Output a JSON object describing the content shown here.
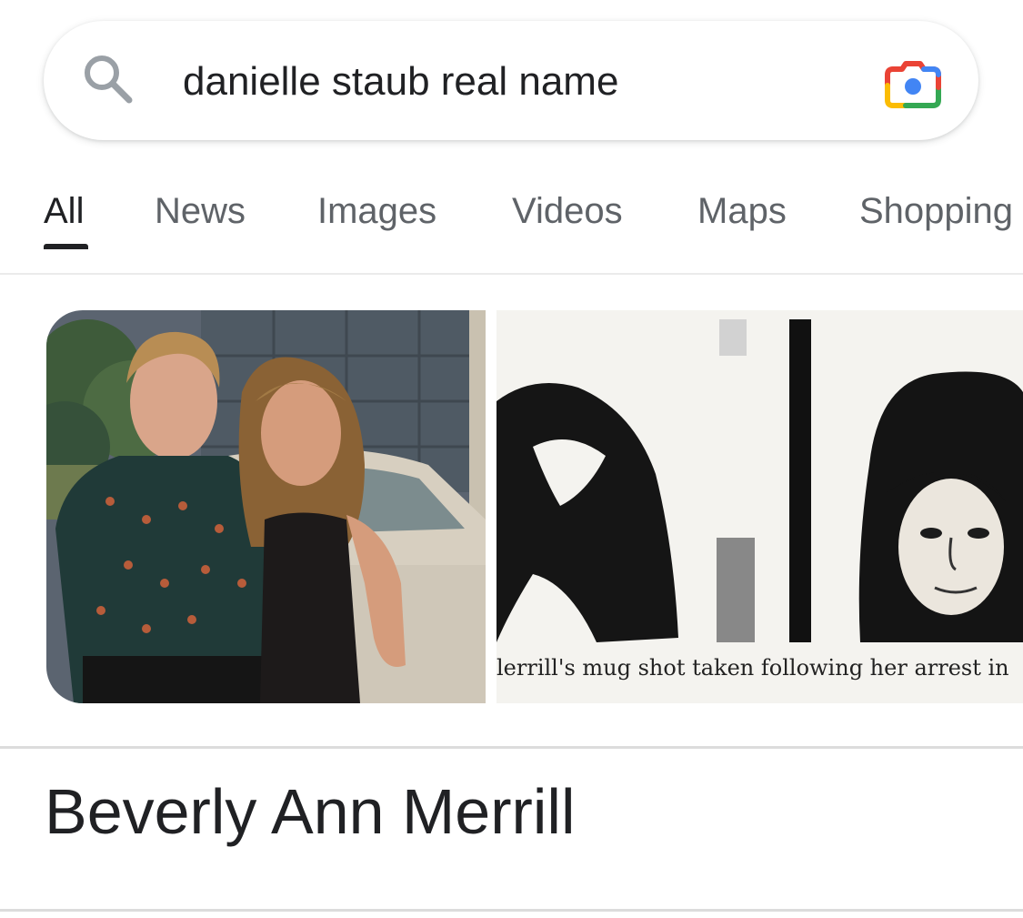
{
  "search": {
    "query": "danielle staub real name"
  },
  "tabs": [
    {
      "label": "All",
      "active": true
    },
    {
      "label": "News",
      "active": false
    },
    {
      "label": "Images",
      "active": false
    },
    {
      "label": "Videos",
      "active": false
    },
    {
      "label": "Maps",
      "active": false
    },
    {
      "label": "Shopping",
      "active": false
    }
  ],
  "images": {
    "second_caption": "lerrill's mug shot taken following her arrest in"
  },
  "answer": {
    "title": "Beverly Ann Merrill"
  },
  "colors": {
    "text_primary": "#202124",
    "text_secondary": "#5f6368",
    "lens_blue": "#4285f4",
    "lens_red": "#ea4335",
    "lens_yellow": "#fbbc04",
    "lens_green": "#34a853"
  }
}
